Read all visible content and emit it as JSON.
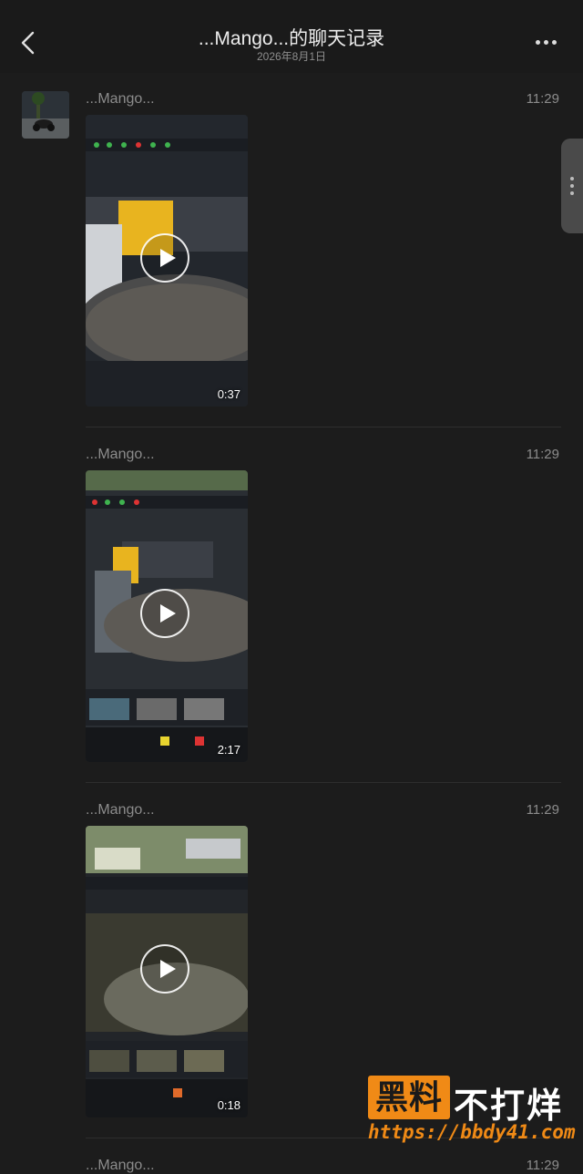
{
  "header": {
    "title": "...Mango...的聊天记录",
    "date": "2026年8月1日"
  },
  "messages": [
    {
      "sender": "...Mango...",
      "time": "11:29",
      "duration": "0:37"
    },
    {
      "sender": "...Mango...",
      "time": "11:29",
      "duration": "2:17"
    },
    {
      "sender": "...Mango...",
      "time": "11:29",
      "duration": "0:18"
    },
    {
      "sender": "...Mango...",
      "time": "11:29"
    }
  ],
  "watermark": {
    "box_text": "黑料",
    "text": "不打烊",
    "url": "https://bbdy41.com"
  },
  "colors": {
    "background": "#1c1c1c",
    "accent": "#f08a16"
  },
  "icons": [
    "back-icon",
    "more-icon",
    "play-icon"
  ]
}
